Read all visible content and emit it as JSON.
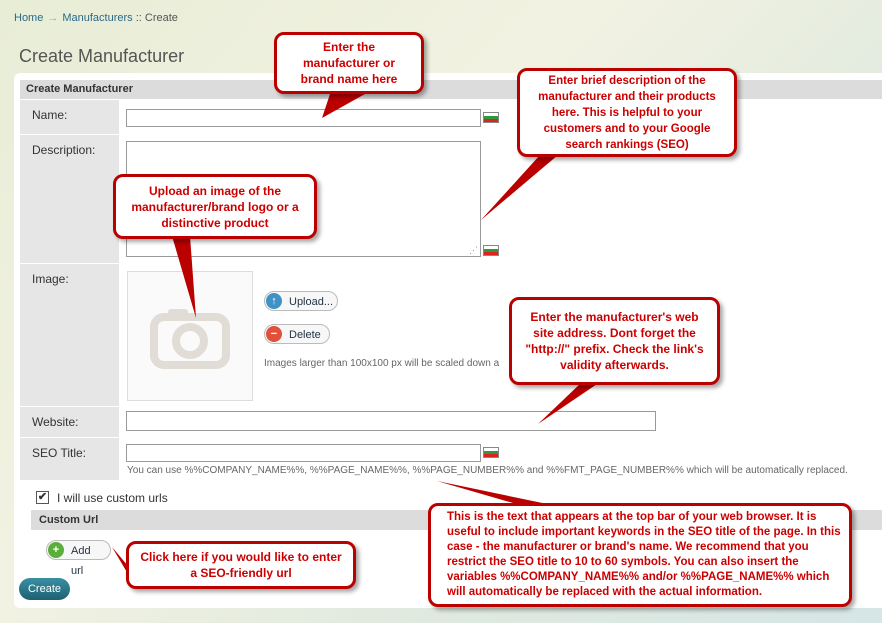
{
  "breadcrumb": {
    "home": "Home",
    "manufacturers": "Manufacturers",
    "sep": "::",
    "current": "Create"
  },
  "page_title": "Create Manufacturer",
  "panel_header": "Create Manufacturer",
  "fields": {
    "name": {
      "label": "Name:",
      "value": ""
    },
    "description": {
      "label": "Description:",
      "value": ""
    },
    "image": {
      "label": "Image:"
    },
    "website": {
      "label": "Website:",
      "value": ""
    },
    "seo_title": {
      "label": "SEO Title:",
      "value": ""
    }
  },
  "image_buttons": {
    "upload": "Upload...",
    "delete": "Delete"
  },
  "image_note": "Images larger than 100x100 px will be scaled down a",
  "seo_note": "You can use %%COMPANY_NAME%%, %%PAGE_NAME%%, %%PAGE_NUMBER%% and %%FMT_PAGE_NUMBER%% which will be automatically replaced.",
  "custom_urls": {
    "checkbox_label": "I will use custom urls",
    "checked": true,
    "header": "Custom Url",
    "add_label": "Add url"
  },
  "create_button": "Create",
  "callouts": {
    "name": "Enter the manufacturer or brand name here",
    "description": "Enter brief description of the manufacturer and their products here. This is helpful to your customers and to your Google search rankings (SEO)",
    "image": "Upload an image of the manufacturer/brand logo or a distinctive product",
    "website": "Enter the manufacturer's web site address. Dont forget the \"http://\" prefix. Check the link's validity afterwards.",
    "seo": "This is the text that appears at the top bar of your web browser. It is useful to include important keywords in the SEO title of the page. In this case  - the manufacturer or brand's name. We recommend that you restrict the SEO title to 10 to 60 symbols. You can also insert the variables %%COMPANY_NAME%% and/or %%PAGE_NAME%% which will automatically be replaced with the actual information.",
    "custom_url": "Click here if you would like to enter a SEO-friendly url"
  },
  "colors": {
    "callout_border": "#b00000",
    "callout_text": "#cc0000",
    "accent": "#2a6a8a"
  },
  "icons": {
    "flag": "language-flag-icon",
    "camera": "camera-placeholder-icon",
    "upload": "arrow-up-icon",
    "delete": "minus-icon",
    "add": "plus-icon"
  }
}
